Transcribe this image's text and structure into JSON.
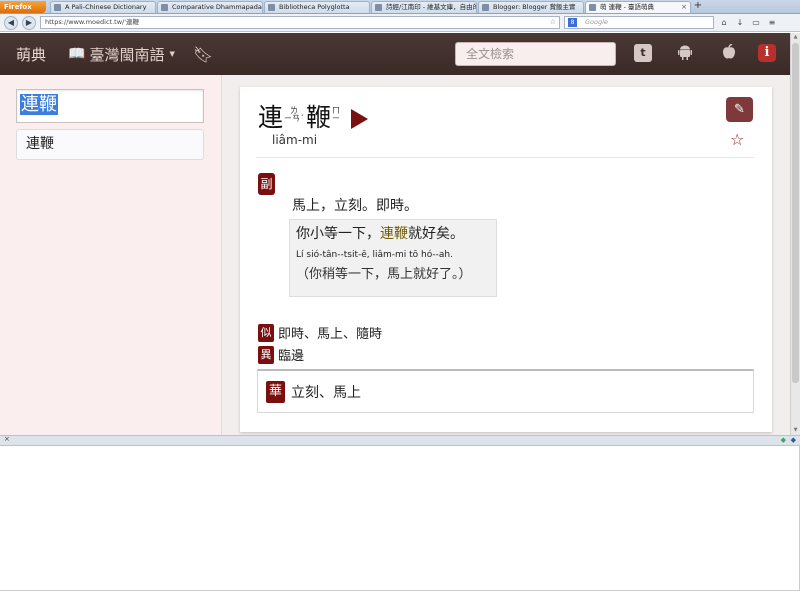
{
  "browser": {
    "firefox_label": "Firefox",
    "tabs": [
      {
        "label": "A Pali-Chinese Dictionary"
      },
      {
        "label": "Comparative Dhammapada - ..."
      },
      {
        "label": "Bibliotheca Polyglotta"
      },
      {
        "label": "詩經/江南印 - 維基文庫，自由的..."
      },
      {
        "label": "Blogger: Blogger 賞飯主實"
      },
      {
        "label": "萌 連鞭 - 臺語萌典"
      }
    ],
    "new_tab": "+",
    "url": "https://www.moedict.tw/'連鞭",
    "search_placeholder": "Google",
    "back_icon": "◀",
    "fwd_icon": "▶"
  },
  "header": {
    "logo": "萌典",
    "brand": "臺灣閩南語",
    "fulltext_placeholder": "全文檢索",
    "twitter_glyph": "t",
    "android_glyph": "🤖",
    "apple_glyph": "",
    "info_glyph": "i"
  },
  "sidebar": {
    "query": "連鞭",
    "results": [
      "連鞭"
    ]
  },
  "entry": {
    "char1": "連",
    "zhuyin1_top": "ㄌ",
    "zhuyin1_bottom": "ㄧㄢˊ",
    "char2": "鞭",
    "zhuyin2_top": "ㄇ",
    "zhuyin2_bottom": "ㄧ",
    "romanization": "liâm-mi",
    "pos": "副",
    "definition": "馬上，立刻。即時。",
    "example": {
      "hz_before": "你小等一下，",
      "hz_highlight": "連鞭",
      "hz_after": "就好矣。",
      "roman": "Lí sió-tân--tsit-ē, liâm-mi tō hó--ah.",
      "translation": "（你稍等一下，馬上就好了。）"
    },
    "synonym_label": "似",
    "synonyms": "即時、馬上、隨時",
    "antonym_label": "異",
    "antonyms": "臨邊",
    "mandarin_label": "華",
    "mandarin": "立刻、馬上"
  },
  "colors": {
    "header_bg": "#3e2e2b",
    "badge": "#7a0f0f",
    "sidebar_bg": "#fbeeee"
  }
}
